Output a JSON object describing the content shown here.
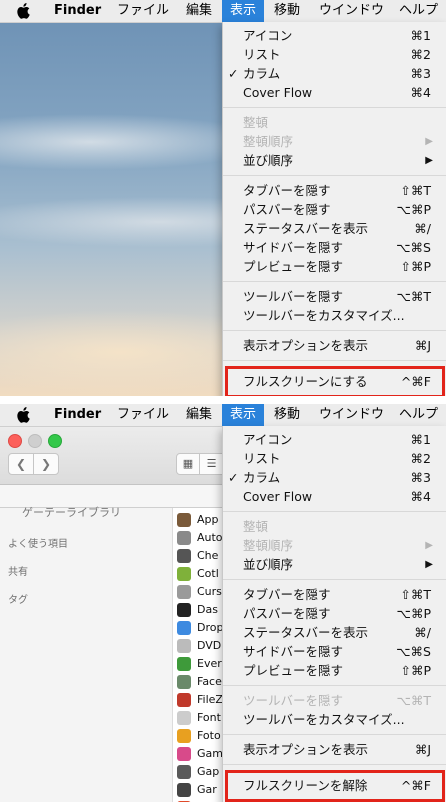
{
  "menubar": {
    "app": "Finder",
    "items": [
      "ファイル",
      "編集",
      "表示",
      "移動",
      "ウインドウ",
      "ヘルプ"
    ]
  },
  "menu_top": {
    "items": [
      {
        "label": "アイコン",
        "shortcut": "⌘1"
      },
      {
        "label": "リスト",
        "shortcut": "⌘2"
      },
      {
        "label": "カラム",
        "shortcut": "⌘3",
        "checked": true
      },
      {
        "label": "Cover Flow",
        "shortcut": "⌘4"
      },
      {
        "label": "整頓",
        "disabled": true
      },
      {
        "label": "整頓順序",
        "disabled": true,
        "submenu": true
      },
      {
        "label": "並び順序",
        "submenu": true
      },
      {
        "label": "タブバーを隠す",
        "shortcut": "⇧⌘T"
      },
      {
        "label": "パスバーを隠す",
        "shortcut": "⌥⌘P"
      },
      {
        "label": "ステータスバーを表示",
        "shortcut": "⌘/"
      },
      {
        "label": "サイドバーを隠す",
        "shortcut": "⌥⌘S"
      },
      {
        "label": "プレビューを隠す",
        "shortcut": "⇧⌘P"
      },
      {
        "label": "ツールバーを隠す",
        "shortcut": "⌥⌘T"
      },
      {
        "label": "ツールバーをカスタマイズ..."
      },
      {
        "label": "表示オプションを表示",
        "shortcut": "⌘J"
      },
      {
        "label": "フルスクリーンにする",
        "shortcut": "^⌘F"
      }
    ]
  },
  "menu_bottom": {
    "items": [
      {
        "label": "アイコン",
        "shortcut": "⌘1"
      },
      {
        "label": "リスト",
        "shortcut": "⌘2"
      },
      {
        "label": "カラム",
        "shortcut": "⌘3",
        "checked": true
      },
      {
        "label": "Cover Flow",
        "shortcut": "⌘4"
      },
      {
        "label": "整頓",
        "disabled": true
      },
      {
        "label": "整頓順序",
        "disabled": true,
        "submenu": true
      },
      {
        "label": "並び順序",
        "submenu": true
      },
      {
        "label": "タブバーを隠す",
        "shortcut": "⇧⌘T"
      },
      {
        "label": "パスバーを隠す",
        "shortcut": "⌥⌘P"
      },
      {
        "label": "ステータスバーを表示",
        "shortcut": "⌘/"
      },
      {
        "label": "サイドバーを隠す",
        "shortcut": "⌥⌘S"
      },
      {
        "label": "プレビューを隠す",
        "shortcut": "⇧⌘P"
      },
      {
        "label": "ツールバーを隠す",
        "shortcut": "⌥⌘T",
        "disabled": true
      },
      {
        "label": "ツールバーをカスタマイズ..."
      },
      {
        "label": "表示オプションを表示",
        "shortcut": "⌘J"
      },
      {
        "label": "フルスクリーンを解除",
        "shortcut": "^⌘F"
      }
    ]
  },
  "highlight_color": "#e2241a",
  "active_menu_color": "#2a82da",
  "finder_window": {
    "sidebar_partial": "ゲーテーライブラリ",
    "sections": [
      "よく使う項目",
      "共有",
      "タグ"
    ],
    "files": [
      {
        "name": "App",
        "color": "#7a5a3a"
      },
      {
        "name": "Auto",
        "color": "#8a8a8a"
      },
      {
        "name": "Che",
        "color": "#555555"
      },
      {
        "name": "Cotl",
        "color": "#7fb13a"
      },
      {
        "name": "Curs",
        "color": "#9a9a9a"
      },
      {
        "name": "Das",
        "color": "#222222"
      },
      {
        "name": "Drop",
        "color": "#3d8ae0"
      },
      {
        "name": "DVD",
        "color": "#bbbbbb"
      },
      {
        "name": "Ever",
        "color": "#3e9a3a"
      },
      {
        "name": "Face",
        "color": "#6a8a6a"
      },
      {
        "name": "FileZ",
        "color": "#c0392b"
      },
      {
        "name": "Font",
        "color": "#cccccc"
      },
      {
        "name": "Foto",
        "color": "#e8a020"
      },
      {
        "name": "Gam",
        "color": "#d84a8a"
      },
      {
        "name": "Gap",
        "color": "#5a5a5a"
      },
      {
        "name": "Gar",
        "color": "#444444"
      },
      {
        "name": "Goo",
        "color": "#e04a2a"
      }
    ]
  }
}
